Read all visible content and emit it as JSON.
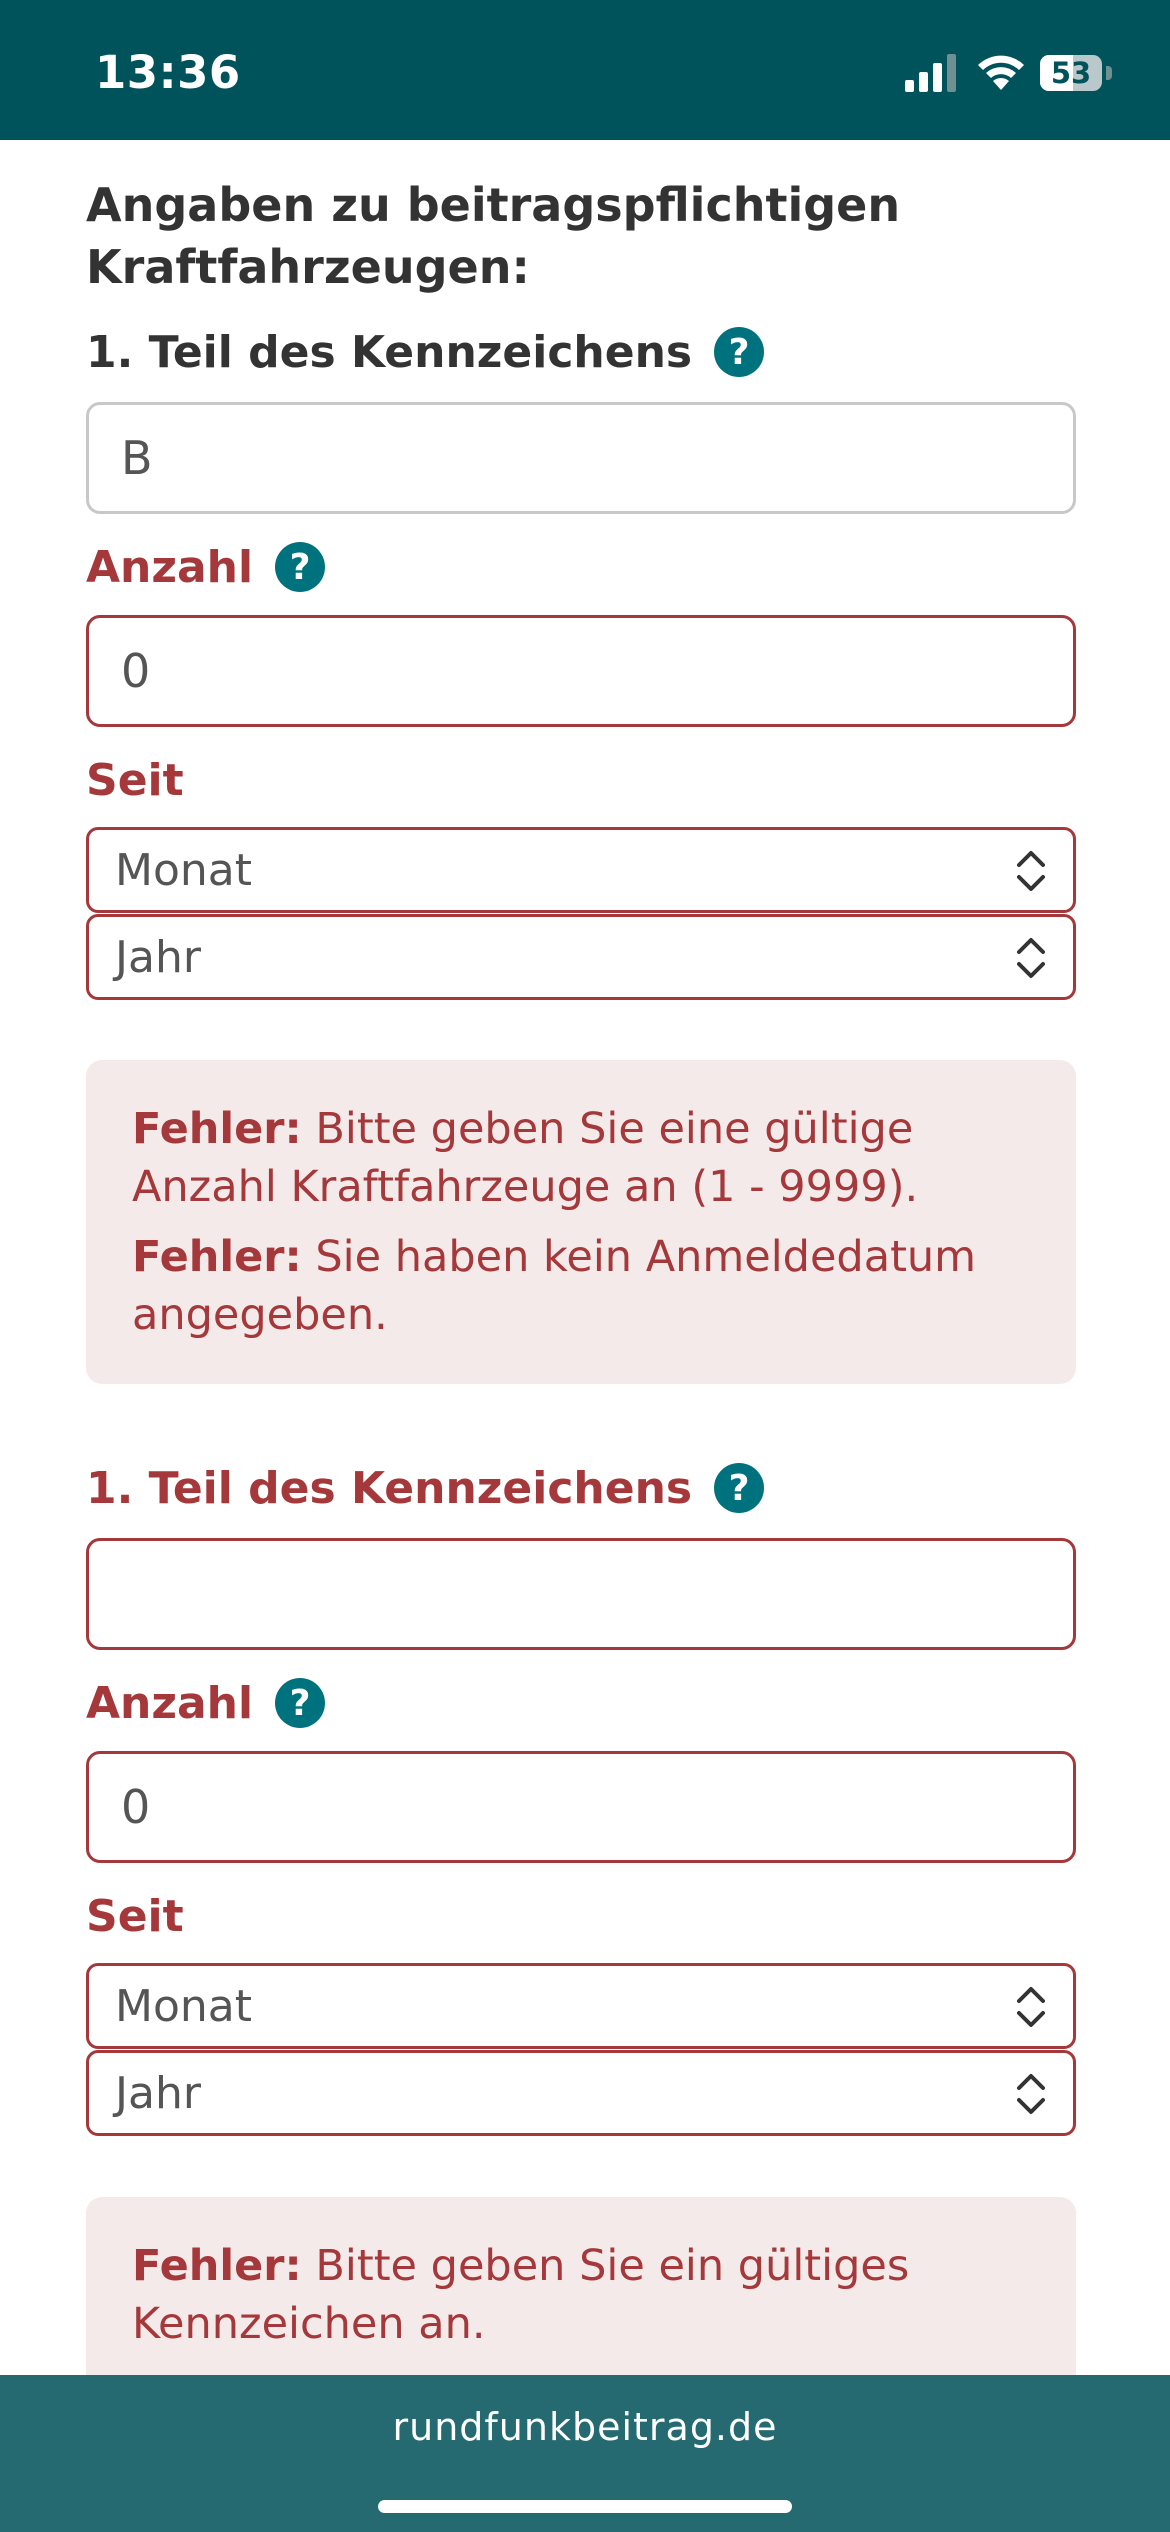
{
  "status_bar": {
    "time": "13:36",
    "battery_level": "53",
    "battery_fraction": 0.53
  },
  "form": {
    "section_title": "Angaben zu beitragspflichtigen Kraftfahrzeugen:",
    "vehicles": [
      {
        "kennzeichen_label": "1. Teil des Kennzeichens",
        "kennzeichen_value": "B",
        "anzahl_label": "Anzahl",
        "anzahl_value": "0",
        "seit_label": "Seit",
        "monat_selected": "Monat",
        "jahr_selected": "Jahr",
        "errors": [
          {
            "prefix": "Fehler:",
            "text": " Bitte geben Sie eine gültige Anzahl Kraftfahrzeuge an (1 - 9999)."
          },
          {
            "prefix": "Fehler:",
            "text": " Sie haben kein Anmeldedatum angegeben."
          }
        ]
      },
      {
        "kennzeichen_label": "1. Teil des Kennzeichens",
        "kennzeichen_value": "",
        "anzahl_label": "Anzahl",
        "anzahl_value": "0",
        "seit_label": "Seit",
        "monat_selected": "Monat",
        "jahr_selected": "Jahr",
        "errors": [
          {
            "prefix": "Fehler:",
            "text": " Bitte geben Sie ein gültiges Kennzeichen an."
          }
        ]
      }
    ]
  },
  "footer": {
    "url": "rundfunkbeitrag.de"
  },
  "colors": {
    "header_bg": "#00535a",
    "error": "#a4383a",
    "error_bg": "#f5eaea",
    "help_icon": "#00727d",
    "footer_bg": "#246a70"
  },
  "icons": [
    "help-icon",
    "chevron-updown-icon",
    "signal-icon",
    "wifi-icon",
    "battery-icon"
  ]
}
